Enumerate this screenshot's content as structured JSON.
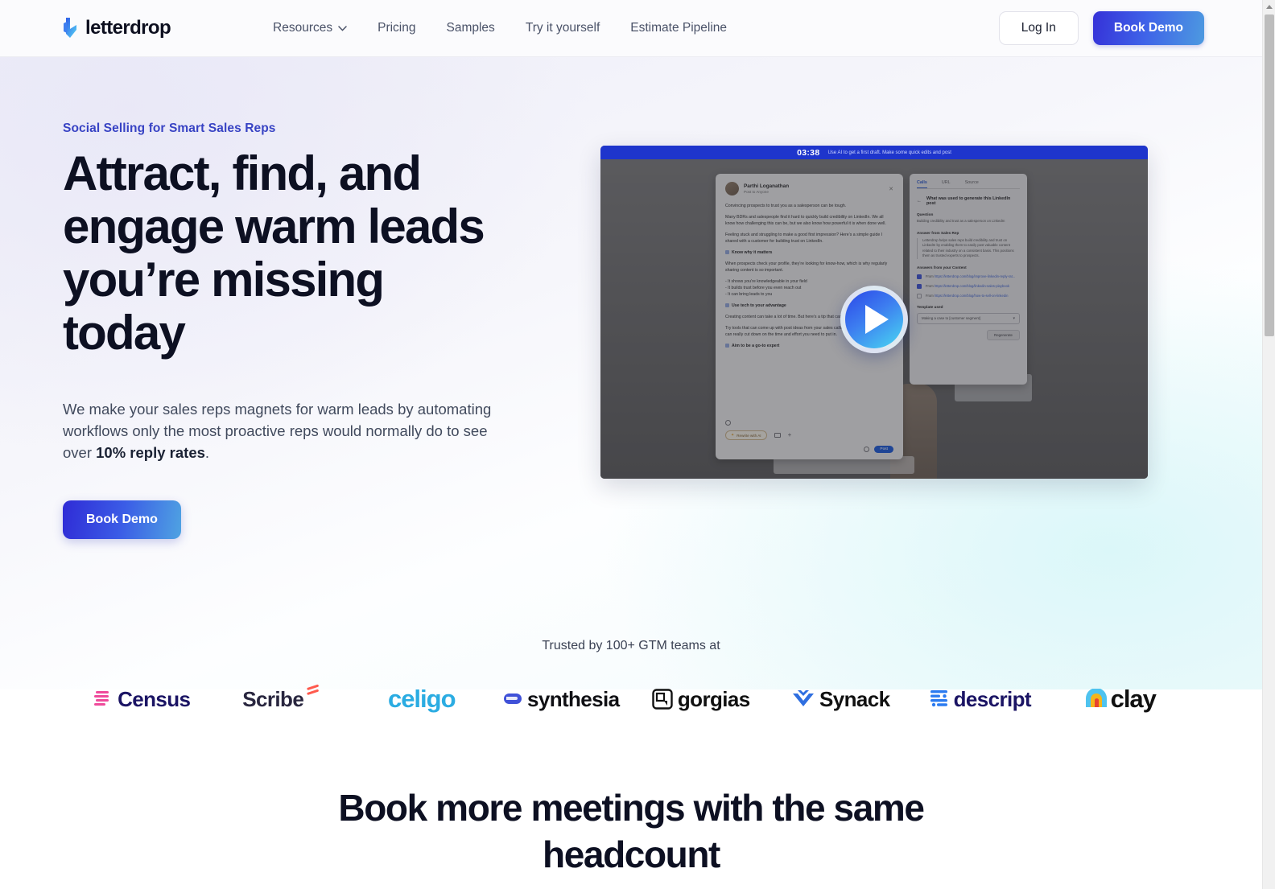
{
  "header": {
    "brand": "letterdrop",
    "brand_icon": "letterdrop-logo-icon",
    "nav": [
      {
        "label": "Resources",
        "has_caret": true
      },
      {
        "label": "Pricing",
        "has_caret": false
      },
      {
        "label": "Samples",
        "has_caret": false
      },
      {
        "label": "Try it yourself",
        "has_caret": false
      },
      {
        "label": "Estimate Pipeline",
        "has_caret": false
      }
    ],
    "login_label": "Log In",
    "demo_label": "Book Demo"
  },
  "hero": {
    "eyebrow": "Social Selling for Smart Sales Reps",
    "title": "Attract, find, and engage warm leads you’re missing today",
    "sub_before": "We make your sales reps magnets for warm leads by automating workflows only the most proactive reps would normally do to see over ",
    "sub_bold": "10% reply rates",
    "sub_after": ".",
    "cta_label": "Book Demo"
  },
  "video": {
    "timer": "03:38",
    "caption": "Use AI to get a first draft. Make some quick edits and post",
    "play_icon": "play-icon",
    "post": {
      "author": "Parthi Loganathan",
      "audience": "Post to Anyone",
      "close_icon": "close-icon",
      "paragraphs": [
        "Convincing prospects to trust you as a salesperson can be tough.",
        "Many BDRs and salespeople find it hard to quickly build credibility on LinkedIn. We all know how challenging this can be, but we also know how powerful it is when done well.",
        "Feeling stuck and struggling to make a good first impression? Here’s a simple guide I shared with a customer for building trust on LinkedIn."
      ],
      "point1": "Know why it matters",
      "after1": "When prospects check your profile, they’re looking for know-how, which is why regularly sharing content is so important.",
      "bullets": [
        "- It shows you’re knowledgeable in your field",
        "- It builds trust before you even reach out",
        "- It can bring leads to you"
      ],
      "point2": "Use tech to your advantage",
      "after2a": "Creating content can take a lot of time. But here’s a tip that can make a big difference:",
      "after2b": "Try tools that can come up with post ideas from your sales calls or industry insights. This can really cut down on the time and effort you need to put in.",
      "point3": "Aim to be a go-to expert",
      "rewrite_label": "Rewrite with AI",
      "post_label": "Post",
      "image_icon": "image-icon",
      "plus_icon": "plus-icon",
      "emoji_icon": "emoji-icon",
      "info_icon": "info-icon"
    },
    "panel": {
      "tabs": [
        "Calls",
        "URL",
        "Source"
      ],
      "active_tab": "Calls",
      "back_icon": "back-arrow-icon",
      "heading": "What was used to generate this LinkedIn post",
      "question_label": "Question",
      "question_value": "Building credibility and trust as a salesperson on LinkedIn",
      "answer_label": "Answer from Sales Rep",
      "answer_value": "Letterdrop helps sales reps build credibility and trust on LinkedIn by enabling them to easily post valuable content related to their industry on a consistent basis. This positions them as trusted experts to prospects.",
      "content_label": "Answers from your Content",
      "sources": [
        {
          "prefix": "From ",
          "url": "https://letterdrop.com/blog/improve-linkedin-reply-rat...",
          "checked": true
        },
        {
          "prefix": "From ",
          "url": "https://letterdrop.com/blog/linkedin-sales-playbook",
          "checked": true
        },
        {
          "prefix": "From ",
          "url": "https://letterdrop.com/blog/how-to-sell-on-linkedin",
          "checked": false
        }
      ],
      "template_label": "Template used",
      "template_value": "Making a case to [customer segment]",
      "regenerate_label": "Regenerate"
    }
  },
  "trusted": {
    "text": "Trusted by 100+ GTM teams at",
    "logos": [
      {
        "name": "Census",
        "icon": "census-logo-icon",
        "color": "#1b1464",
        "accent": "#ef4a9b"
      },
      {
        "name": "Scribe",
        "icon": "scribe-logo-icon",
        "color": "#29263f",
        "accent": "#ff5a4d"
      },
      {
        "name": "celigo",
        "icon": "celigo-logo-icon",
        "color": "#2bace2",
        "accent": "#2bace2"
      },
      {
        "name": "synthesia",
        "icon": "synthesia-logo-icon",
        "color": "#101014",
        "accent": "#4051d8"
      },
      {
        "name": "gorgias",
        "icon": "gorgias-logo-icon",
        "color": "#111111",
        "accent": "#111111"
      },
      {
        "name": "Synack",
        "icon": "synack-logo-icon",
        "color": "#111111",
        "accent": "#2f6fe0"
      },
      {
        "name": "descript",
        "icon": "descript-logo-icon",
        "color": "#1b1464",
        "accent": "#2b7bf0"
      },
      {
        "name": "clay",
        "icon": "clay-logo-icon",
        "color": "#111111",
        "accent": "#f5b51a"
      }
    ]
  },
  "section2": {
    "title": "Book more meetings with the same headcount"
  }
}
